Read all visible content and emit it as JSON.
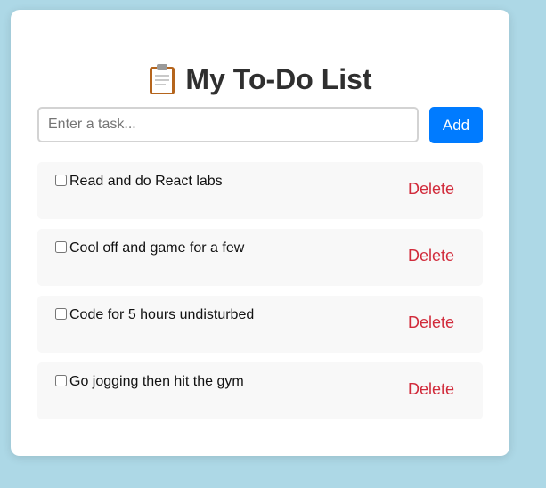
{
  "header": {
    "icon": "clipboard-icon",
    "title": "My To-Do List"
  },
  "form": {
    "placeholder": "Enter a task...",
    "value": "",
    "add_label": "Add"
  },
  "tasks": [
    {
      "text": "Read and do React labs",
      "done": false,
      "delete_label": "Delete"
    },
    {
      "text": "Cool off and game for a few",
      "done": false,
      "delete_label": "Delete"
    },
    {
      "text": "Code for 5 hours undisturbed",
      "done": false,
      "delete_label": "Delete"
    },
    {
      "text": "Go jogging then hit the gym",
      "done": false,
      "delete_label": "Delete"
    }
  ],
  "colors": {
    "page_bg": "#add8e6",
    "add_button": "#007bff",
    "delete_text": "#d12b3b"
  }
}
